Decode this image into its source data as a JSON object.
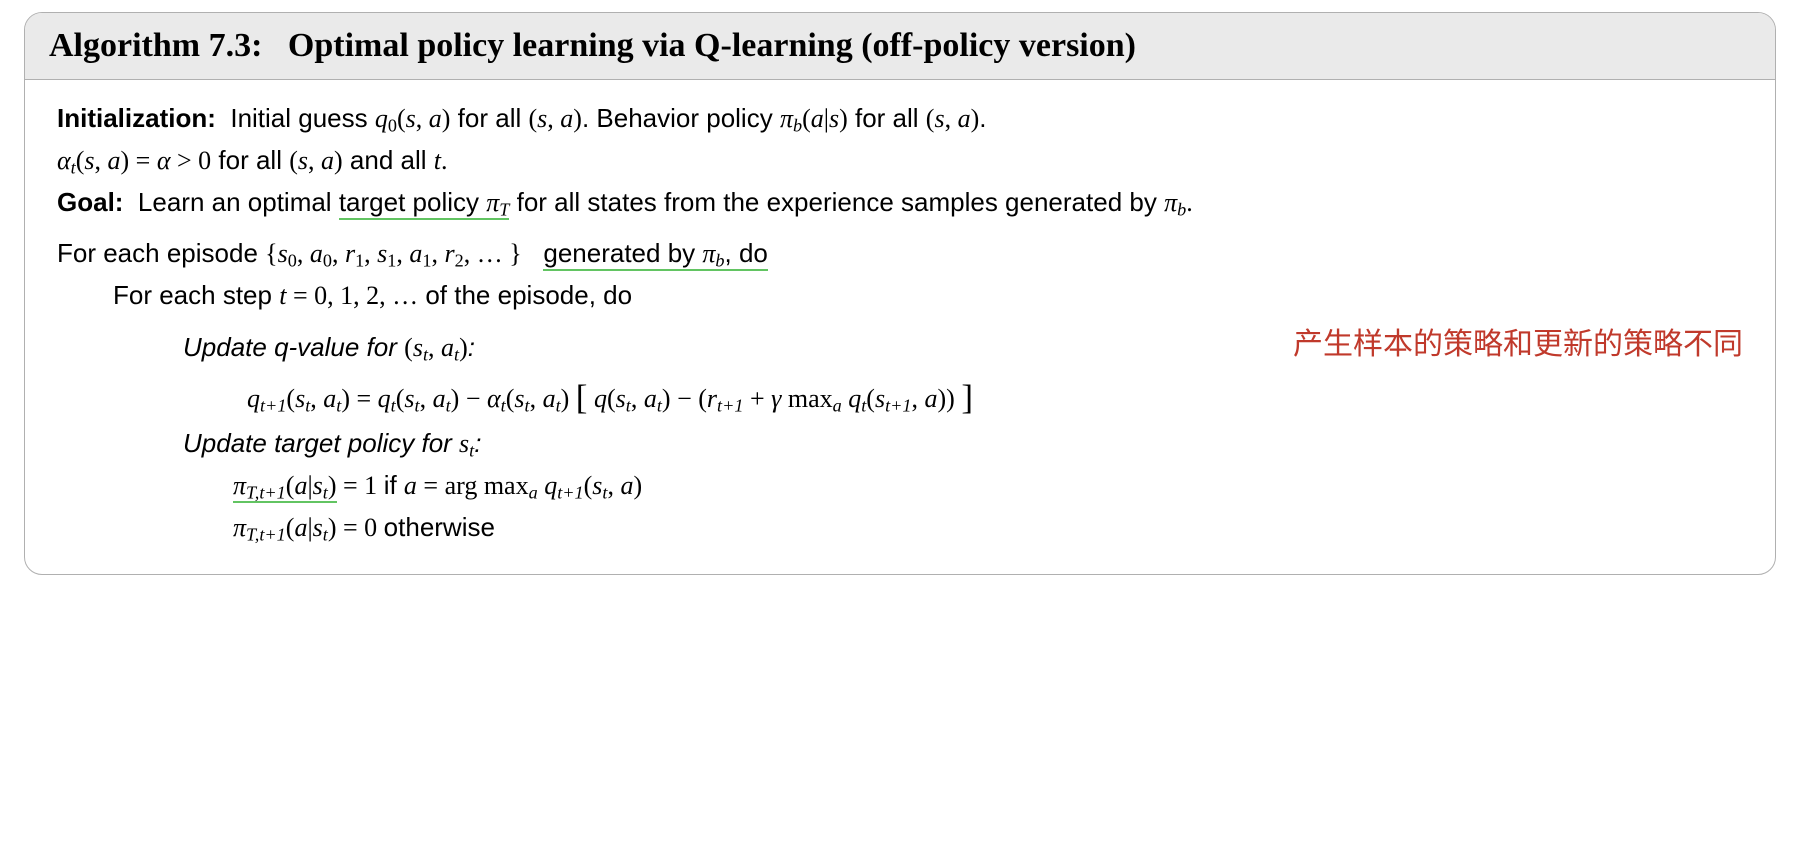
{
  "algo": {
    "number": "Algorithm 7.3:",
    "title": "Optimal policy learning via Q-learning (off-policy version)",
    "init_label": "Initialization:",
    "init_text_1": "Initial guess ",
    "init_text_2": " for all ",
    "init_text_3": ".  Behavior policy ",
    "init_text_4": " for all ",
    "init_text_5": ".",
    "init_line2_a": " for all ",
    "init_line2_b": " and all ",
    "goal_label": "Goal:",
    "goal_text_1": "Learn an optimal ",
    "goal_target": "target policy ",
    "goal_text_2": " for all states from the experience samples generated by ",
    "loop1_a": "For each episode ",
    "loop1_b_underlined": "generated by ",
    "loop1_c": ", do",
    "loop2": "For each step ",
    "loop2_b": " of the episode, do",
    "step1": "Update q-value for ",
    "step1_colon": ":",
    "annotation": "产生样本的策略和更新的策略不同",
    "step2": "Update target policy for ",
    "step2_colon": ":",
    "pi_eq1_cond": " if ",
    "pi_eq0_cond": " otherwise"
  }
}
